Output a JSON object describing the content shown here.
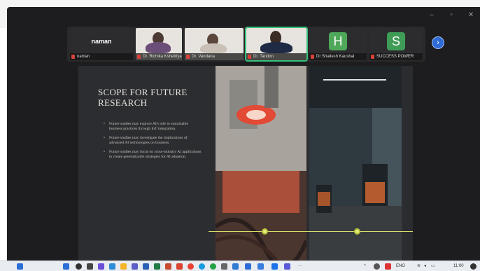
{
  "participants": {
    "main_name": "naman",
    "tiles": [
      {
        "label": "naman"
      },
      {
        "label": "Dr. Richika Kshetriya"
      },
      {
        "label": "Dr. Vandana"
      },
      {
        "label": "Dr. Tandon"
      },
      {
        "label": "Dr Shailesh Kaushal",
        "avatar": "H"
      },
      {
        "label": "SUCCESS POWER",
        "avatar": "S"
      }
    ],
    "next_icon": "chevron-right-icon"
  },
  "slide": {
    "title": "SCOPE FOR FUTURE RESEARCH",
    "bullets": [
      "Future studies may explore AI's role in sustainable business practices through IoT integration.",
      "Future studies may investigate the implications of advanced AI technologies on business.",
      "Future studies may focus on cross-industry AI applications to create generalizable strategies for AI adoption."
    ]
  },
  "taskbar": {
    "lang": "ENG",
    "time": "11:00"
  },
  "colors": {
    "accent_green": "#38c07a",
    "avatar_green": "#4fa85a",
    "next_blue": "#2f6bd6",
    "slide_bg": "#2c2d30"
  }
}
